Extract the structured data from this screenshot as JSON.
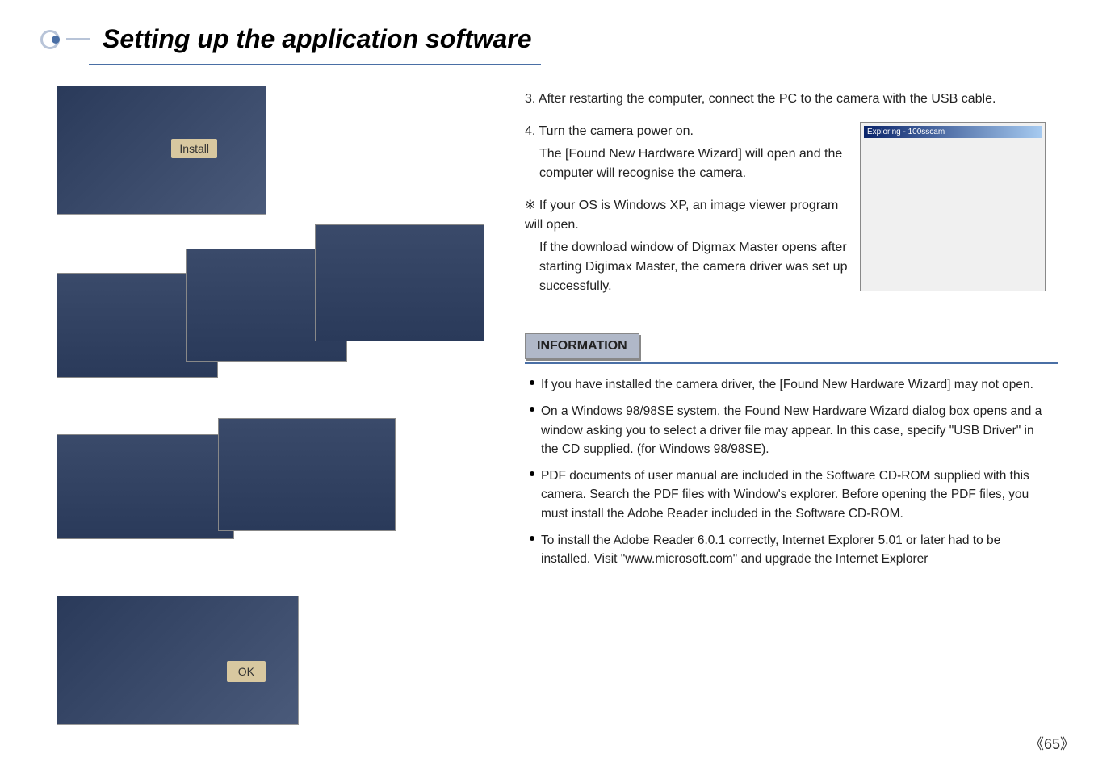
{
  "title": "Setting up the application software",
  "screenshots": {
    "install_label": "Install",
    "ok_label": "OK",
    "explorer_title": "Exploring - 100sscam"
  },
  "steps": {
    "s3": "3. After restarting the computer, connect the PC to the camera with the USB cable.",
    "s4_line1": "4. Turn the camera power on.",
    "s4_line2": "The [Found New Hardware Wizard] will open and the computer will recognise the camera.",
    "note_symbol": "※",
    "note": "If your OS is Windows XP, an image viewer program will open.",
    "note2": "If the download window of Digmax Master opens after starting Digimax Master, the camera driver was set up successfully."
  },
  "info": {
    "header": "INFORMATION",
    "items": [
      "If you have installed the camera driver, the [Found New Hardware Wizard] may not open.",
      "On a Windows 98/98SE system, the Found New Hardware Wizard dialog box opens and a window asking you to select a driver file may appear. In this case, specify \"USB Driver\" in the CD supplied. (for Windows 98/98SE).",
      "PDF documents of user manual are included in the Software CD-ROM supplied with this camera. Search the PDF files with Window's explorer. Before opening the PDF files, you must install the Adobe Reader included in the Software CD-ROM.",
      "To install the Adobe Reader 6.0.1 correctly, Internet Explorer 5.01 or later had to be installed. Visit \"www.microsoft.com\" and upgrade the Internet Explorer"
    ]
  },
  "page_number": "65"
}
